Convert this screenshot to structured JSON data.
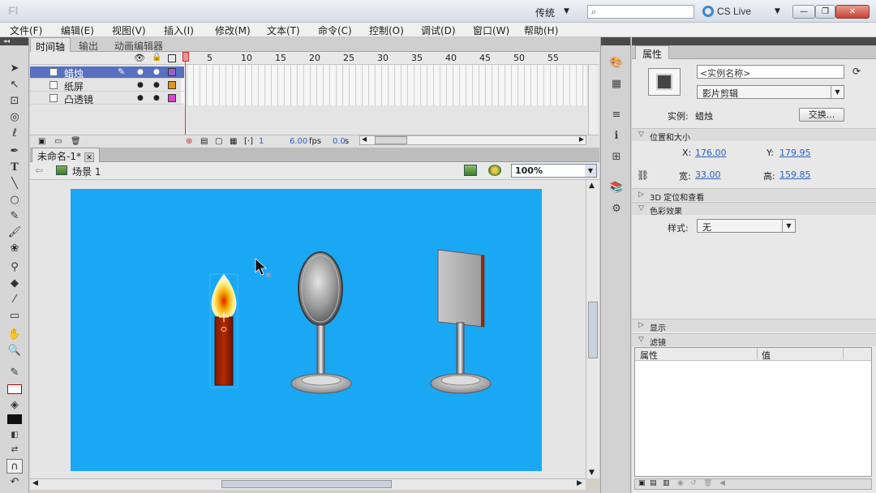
{
  "titlebar": {
    "app_logo": "Fl",
    "workspace": "传统",
    "search_placeholder": "",
    "cs_live": "CS Live"
  },
  "menu": [
    "文件(F)",
    "编辑(E)",
    "视图(V)",
    "插入(I)",
    "修改(M)",
    "文本(T)",
    "命令(C)",
    "控制(O)",
    "调试(D)",
    "窗口(W)",
    "帮助(H)"
  ],
  "timeline": {
    "tabs": [
      "时间轴",
      "输出",
      "动画编辑器"
    ],
    "frame_numbers": [
      "1",
      "5",
      "10",
      "15",
      "20",
      "25",
      "30",
      "35",
      "40",
      "45",
      "50",
      "55"
    ],
    "layers": [
      {
        "name": "蜡烛",
        "color": "#9b5fd0",
        "selected": true
      },
      {
        "name": "纸屏",
        "color": "#e09a10",
        "selected": false
      },
      {
        "name": "凸透镜",
        "color": "#e040d8",
        "selected": false
      }
    ],
    "current_frame": "1",
    "fps": "6.00",
    "fps_unit": "fps",
    "time": "0.0",
    "time_unit": "s"
  },
  "document": {
    "tab_label": "未命名-1*",
    "scene_label": "场景 1",
    "zoom": "100%",
    "stage_color": "#1aa8f5"
  },
  "properties": {
    "tab": "属性",
    "instance_name_placeholder": "<实例名称>",
    "instance_type": "影片剪辑",
    "instance_label": "实例:",
    "instance_value": "蜡烛",
    "swap_button": "交换...",
    "section_position": "位置和大小",
    "x_label": "X:",
    "x_value": "176.00",
    "y_label": "Y:",
    "y_value": "179.95",
    "w_label": "宽:",
    "w_value": "33.00",
    "h_label": "高:",
    "h_value": "159.85",
    "section_3d": "3D 定位和查看",
    "section_color": "色彩效果",
    "style_label": "样式:",
    "style_value": "无",
    "section_display": "显示",
    "section_filters": "滤镜",
    "filter_col_property": "属性",
    "filter_col_value": "值"
  }
}
